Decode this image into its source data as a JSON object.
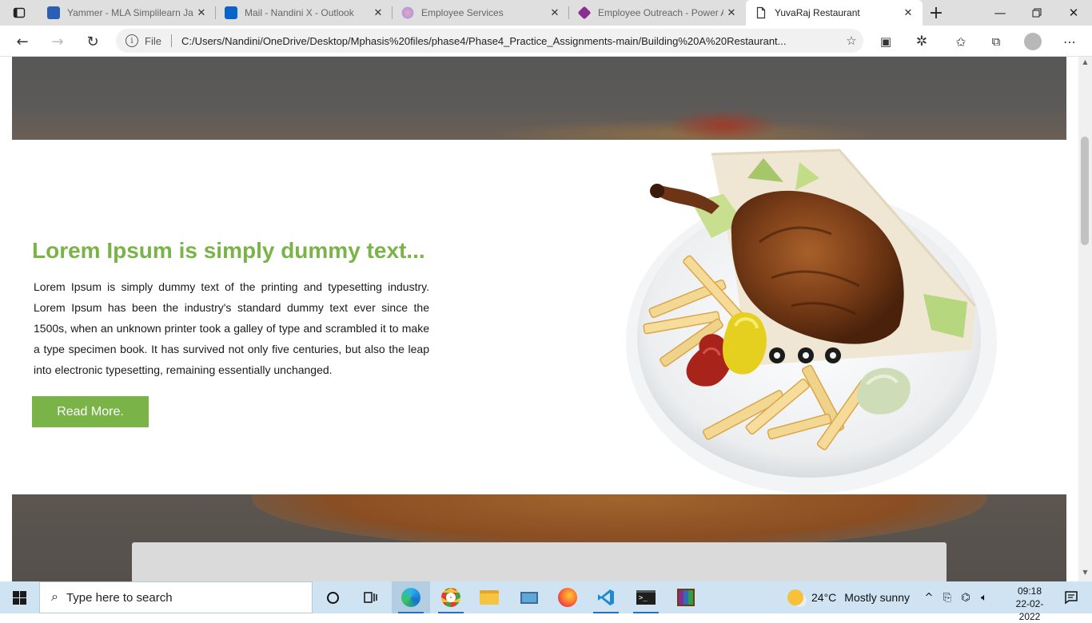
{
  "browser": {
    "tabs": [
      {
        "label": "Yammer - MLA Simplilearn Ja",
        "icon": "yammer-icon",
        "state": "inactive"
      },
      {
        "label": "Mail - Nandini X - Outlook",
        "icon": "outlook-icon",
        "state": "inactive"
      },
      {
        "label": "Employee Services",
        "icon": "employee-services-icon",
        "state": "inactive"
      },
      {
        "label": "Employee Outreach - Power A",
        "icon": "power-apps-icon",
        "state": "inactive"
      },
      {
        "label": "YuvaRaj Restaurant",
        "icon": "page-icon",
        "state": "active"
      }
    ],
    "address": {
      "scheme": "File",
      "url": "C:/Users/Nandini/OneDrive/Desktop/Mphasis%20files/phase4/Phase4_Practice_Assignments-main/Building%20A%20Restaurant..."
    }
  },
  "page": {
    "headline": "Lorem Ipsum is simply dummy text...",
    "body": "Lorem Ipsum is simply dummy text of the printing and typesetting industry. Lorem Ipsum has been the industry's standard dummy text ever since the 1500s, when an unknown printer took a galley of type and scrambled it to make a type specimen book. It has survived not only five centuries, but also the leap into electronic typesetting, remaining essentially unchanged.",
    "button": "Read More.",
    "accent_color": "#7ab348"
  },
  "taskbar": {
    "search_placeholder": "Type here to search",
    "weather_temp": "24°C",
    "weather_text": "Mostly sunny",
    "time": "09:18",
    "date": "22-02-2022"
  }
}
